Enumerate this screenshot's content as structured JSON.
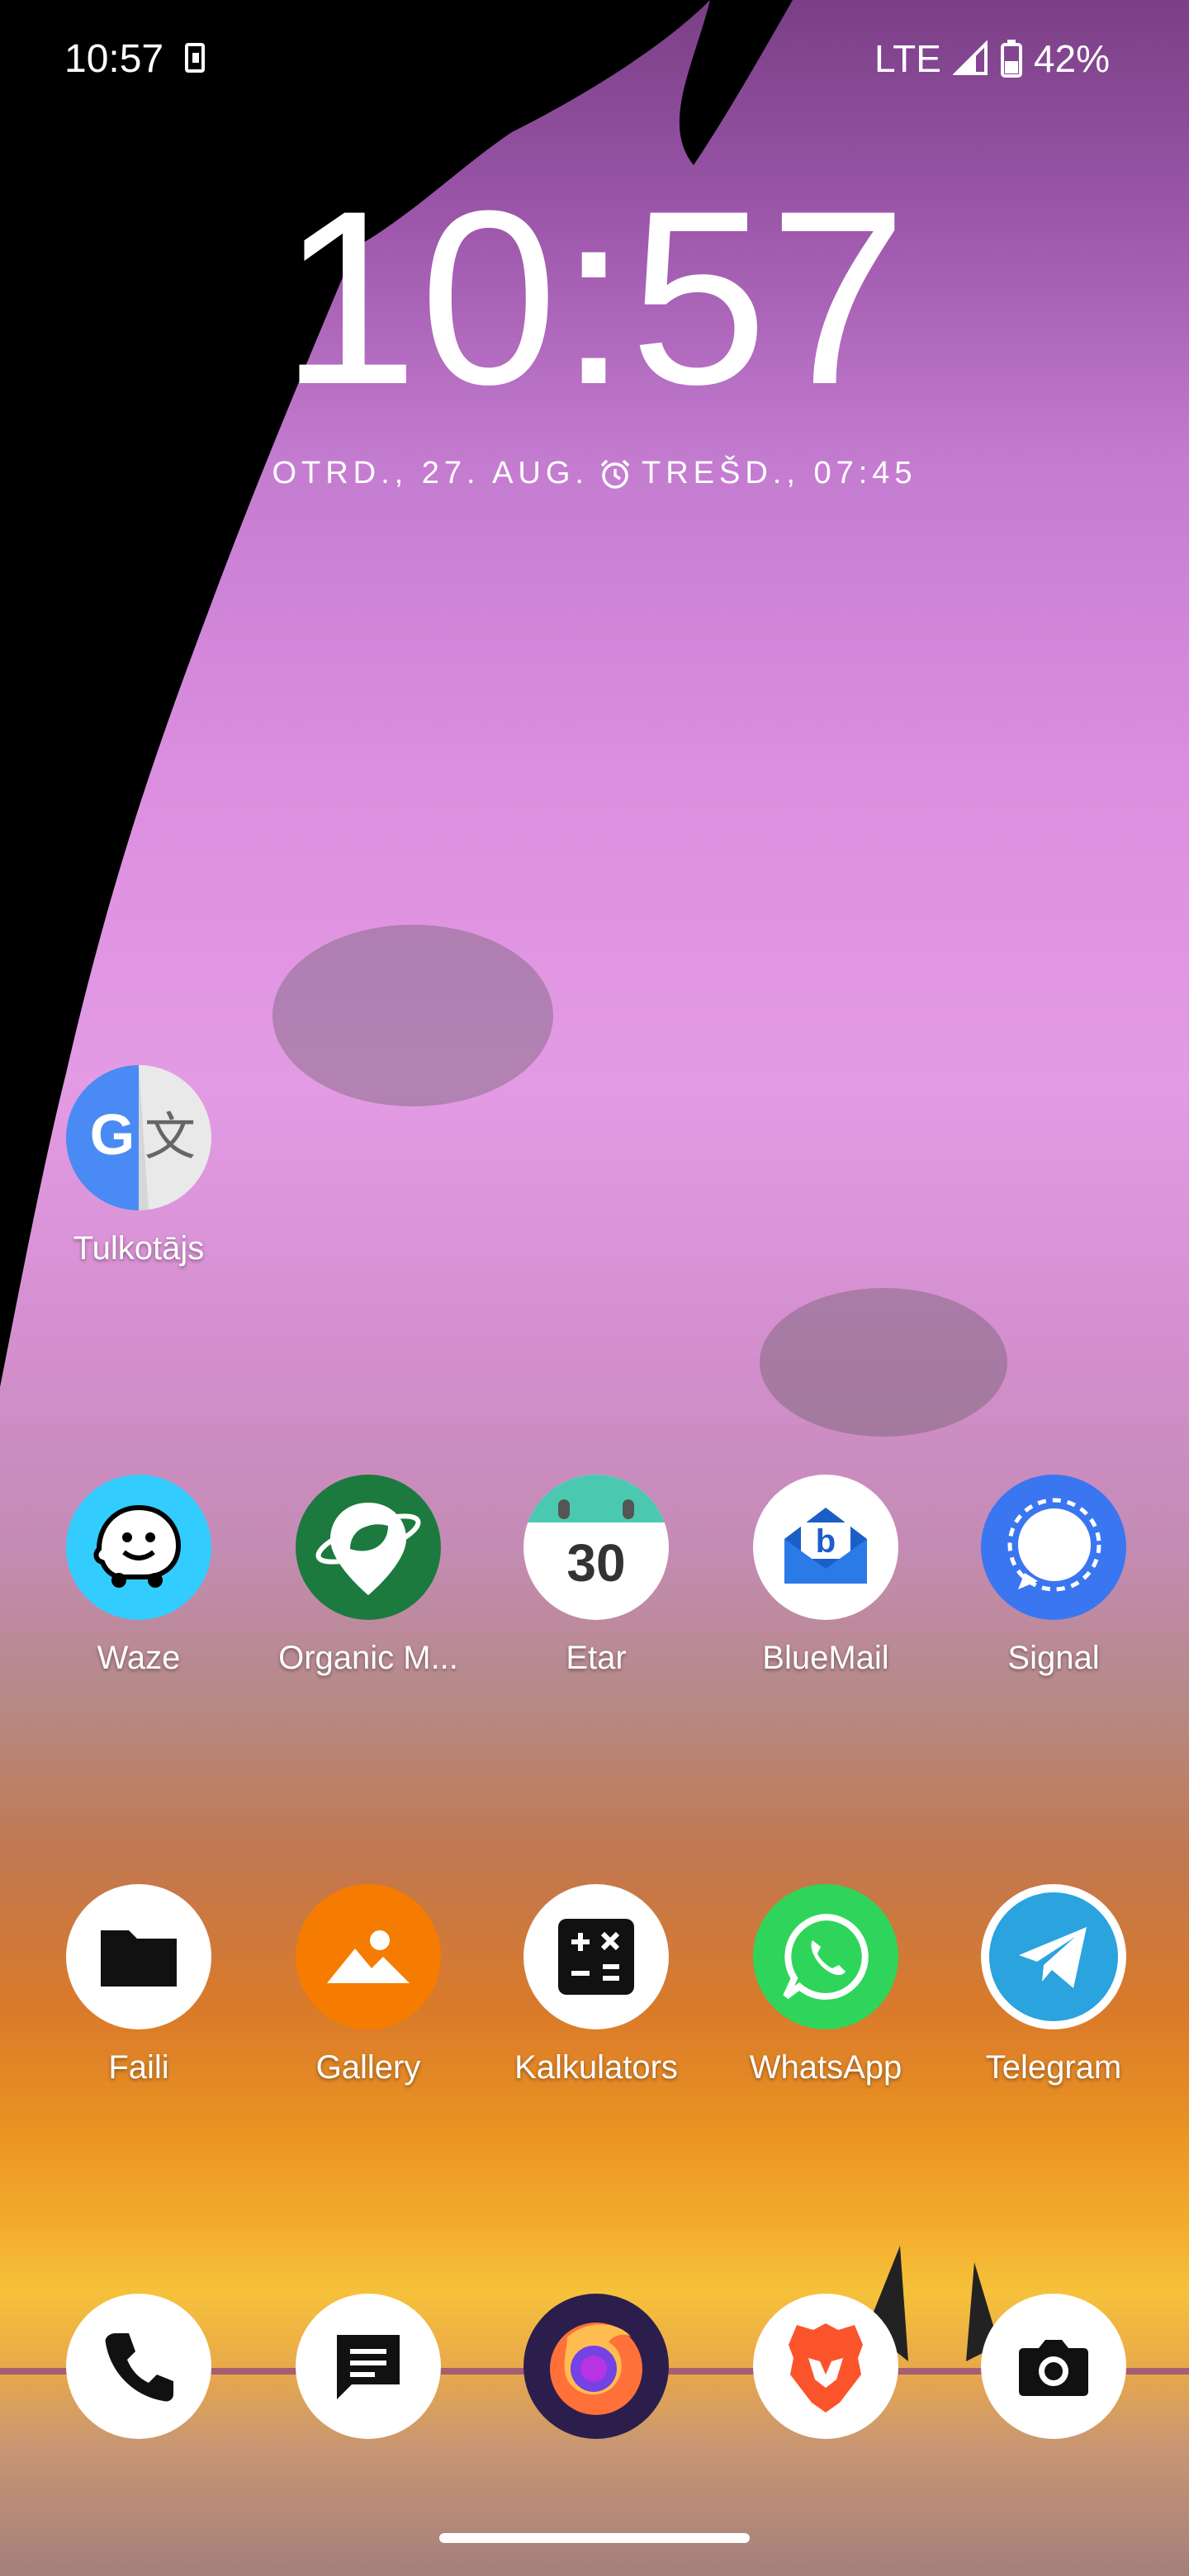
{
  "status_bar": {
    "time": "10:57",
    "network": "LTE",
    "battery": "42%"
  },
  "lockclock": {
    "time": "10:57",
    "date": "OTRD., 27. AUG.",
    "alarm": "TREŠD., 07:45"
  },
  "apps": {
    "translate": "Tulkotājs",
    "waze": "Waze",
    "organic": "Organic M...",
    "etar": "Etar",
    "etar_day": "30",
    "bluemail": "BlueMail",
    "signal": "Signal",
    "files": "Faili",
    "gallery": "Gallery",
    "calculator": "Kalkulators",
    "whatsapp": "WhatsApp",
    "telegram": "Telegram"
  },
  "dock": [
    "phone-icon",
    "messages-icon",
    "firefox-icon",
    "brave-icon",
    "camera-icon"
  ]
}
